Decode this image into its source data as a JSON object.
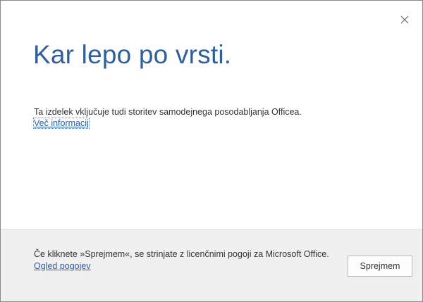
{
  "dialog": {
    "title": "Kar lepo po vrsti.",
    "close_icon": "close-icon",
    "body_text": "Ta izdelek vključuje tudi storitev samodejnega posodabljanja Officea.",
    "body_link": "Več informacij"
  },
  "footer": {
    "license_text": "Če kliknete »Sprejmem«, se strinjate z licenčnimi pogoji za Microsoft Office.",
    "terms_link": "Ogled pogojev",
    "accept_label": "Sprejmem"
  },
  "colors": {
    "title": "#2f5f9c",
    "link": "#2a5ea8",
    "footer_bg": "#f0f0f0"
  }
}
